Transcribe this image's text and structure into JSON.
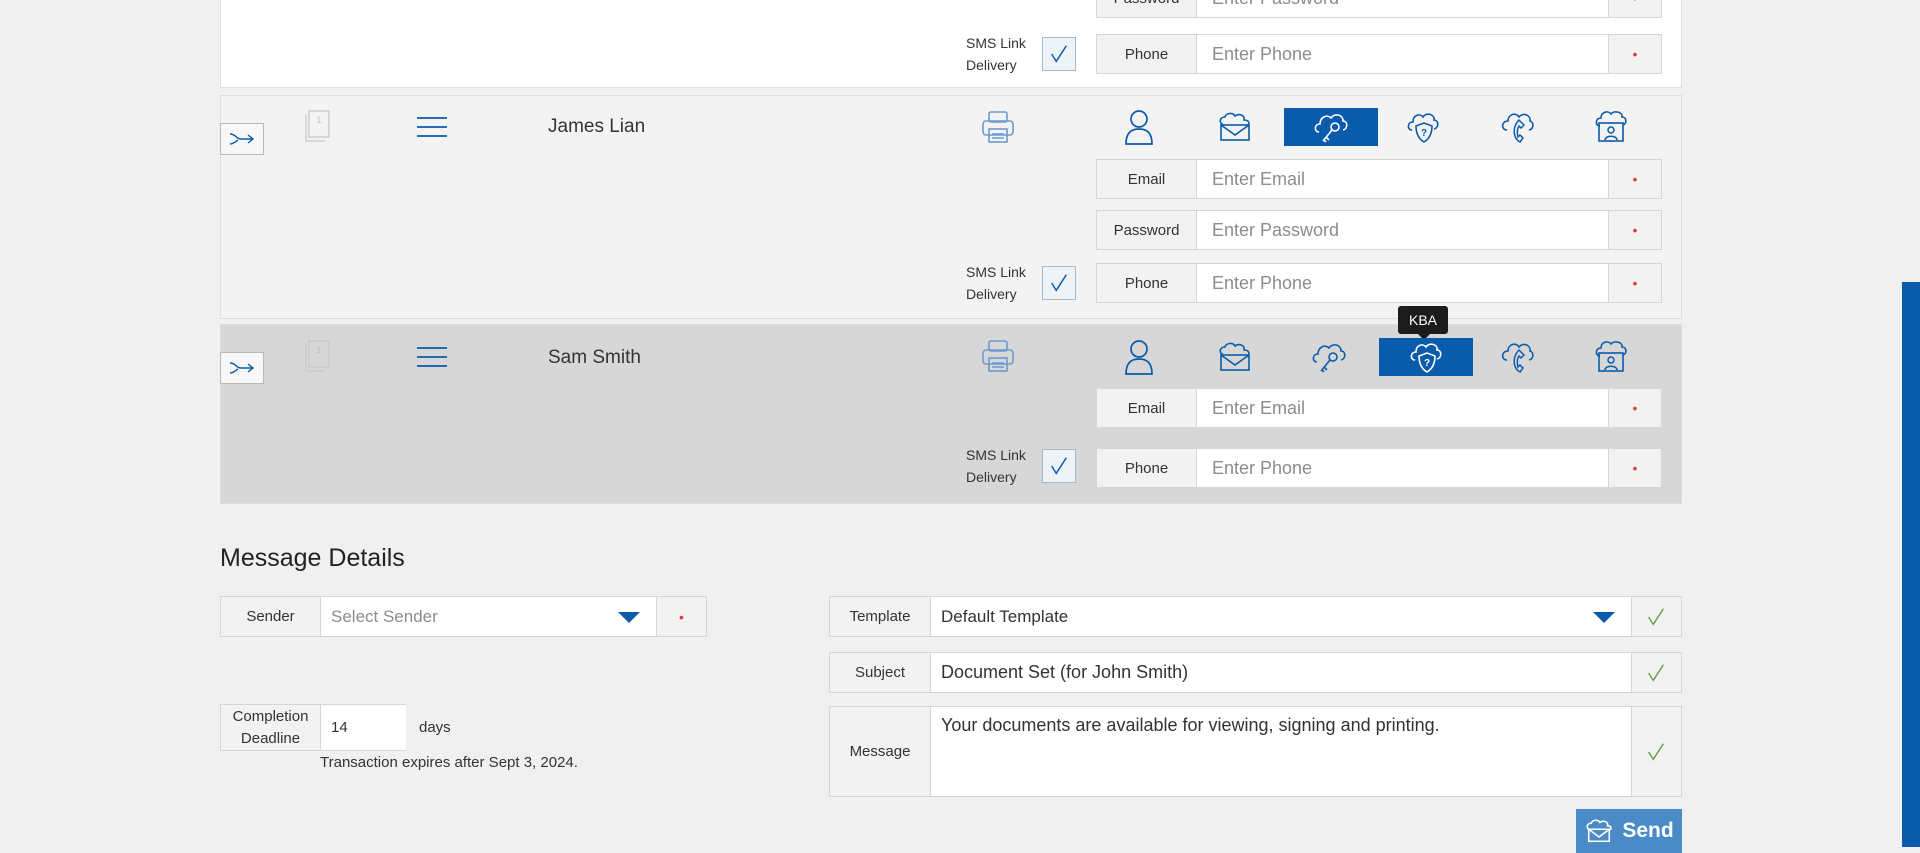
{
  "colors": {
    "accent": "#0a5bab",
    "required": "#d64545",
    "check_green": "#6a9f4e"
  },
  "signers": [
    {
      "name": "",
      "fields": [
        {
          "label": "Password",
          "placeholder": "Enter Password"
        },
        {
          "label": "Phone",
          "placeholder": "Enter Phone"
        }
      ],
      "sms": {
        "line1": "SMS Link",
        "line2": "Delivery"
      }
    },
    {
      "name": "James Lian",
      "doc_count": "1",
      "active_auth": "password-icon",
      "fields": [
        {
          "label": "Email",
          "placeholder": "Enter Email"
        },
        {
          "label": "Password",
          "placeholder": "Enter Password"
        },
        {
          "label": "Phone",
          "placeholder": "Enter Phone"
        }
      ],
      "sms": {
        "line1": "SMS Link",
        "line2": "Delivery"
      }
    },
    {
      "name": "Sam Smith",
      "doc_count": "1",
      "active_auth": "kba-icon",
      "tooltip": "KBA",
      "fields": [
        {
          "label": "Email",
          "placeholder": "Enter Email"
        },
        {
          "label": "Phone",
          "placeholder": "Enter Phone"
        }
      ],
      "sms": {
        "line1": "SMS Link",
        "line2": "Delivery"
      }
    }
  ],
  "required_mark": "•",
  "message_details": {
    "title": "Message Details",
    "sender": {
      "label": "Sender",
      "placeholder": "Select Sender"
    },
    "template": {
      "label": "Template",
      "value": "Default Template"
    },
    "subject": {
      "label": "Subject",
      "value": "Document Set (for John Smith)"
    },
    "message": {
      "label": "Message",
      "value": "Your documents are available for viewing, signing and printing."
    },
    "deadline": {
      "label_line1": "Completion",
      "label_line2": "Deadline",
      "value": "14",
      "unit": "days"
    },
    "expiry_note": "Transaction expires after Sept 3, 2024.",
    "send_label": "Send"
  }
}
